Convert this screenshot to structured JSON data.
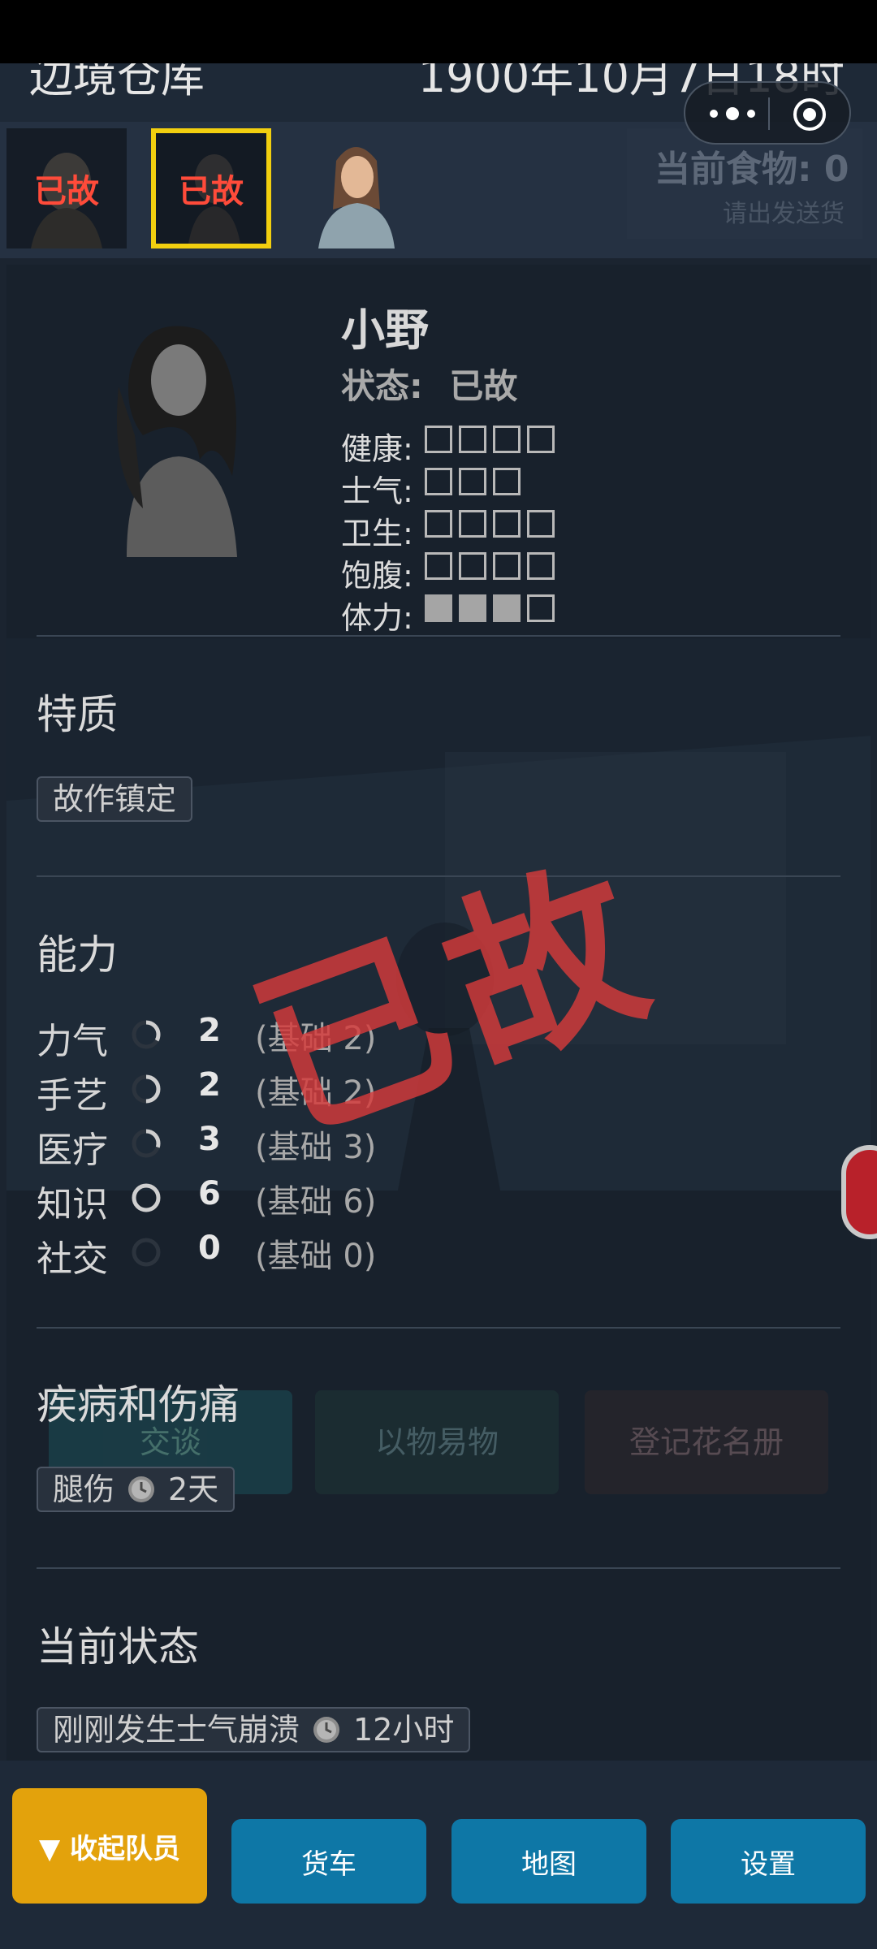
{
  "app": {
    "location_title": "边境仓库",
    "datetime": "1900年10月7日18时"
  },
  "crew": {
    "thumbnails": [
      {
        "dead_label": "已故",
        "selected": false
      },
      {
        "dead_label": "已故",
        "selected": true
      },
      {
        "dead_label": "",
        "selected": false
      }
    ]
  },
  "hud": {
    "food_label": "当前食物: 0",
    "food_sub": "请出发送货"
  },
  "character": {
    "name": "小野",
    "status_label": "状态:",
    "status_value": "已故",
    "stats": [
      {
        "label": "健康:",
        "filled": 0,
        "max": 4
      },
      {
        "label": "士气:",
        "filled": 0,
        "max": 3
      },
      {
        "label": "卫生:",
        "filled": 0,
        "max": 4
      },
      {
        "label": "饱腹:",
        "filled": 0,
        "max": 4
      },
      {
        "label": "体力:",
        "filled": 3,
        "max": 4
      }
    ],
    "stamp": "已故"
  },
  "traits": {
    "title": "特质",
    "items": [
      "故作镇定"
    ]
  },
  "abilities": {
    "title": "能力",
    "items": [
      {
        "label": "力气",
        "value": "2",
        "base": "(基础 2)",
        "level": 0.33
      },
      {
        "label": "手艺",
        "value": "2",
        "base": "(基础 2)",
        "level": 0.5
      },
      {
        "label": "医疗",
        "value": "3",
        "base": "(基础 3)",
        "level": 0.3
      },
      {
        "label": "知识",
        "value": "6",
        "base": "(基础 6)",
        "level": 1.0
      },
      {
        "label": "社交",
        "value": "0",
        "base": "(基础 0)",
        "level": 0.0
      }
    ]
  },
  "ailments": {
    "title": "疾病和伤痛",
    "items": [
      {
        "label": "腿伤",
        "duration": "2天"
      }
    ]
  },
  "current_status": {
    "title": "当前状态",
    "items": [
      {
        "label": "刚刚发生士气崩溃",
        "duration": "12小时"
      }
    ]
  },
  "background_buttons": [
    "交谈",
    "以物易物",
    "登记花名册"
  ],
  "bottom_nav": {
    "collapse_label": "▼ 收起队员",
    "buttons": [
      "货车",
      "地图",
      "设置"
    ]
  },
  "colors": {
    "accent_yellow": "#f2cf0f",
    "dead_red": "#ff4b3a",
    "nav_blue": "#0e77a6",
    "collapse_orange": "#e3a20c"
  }
}
